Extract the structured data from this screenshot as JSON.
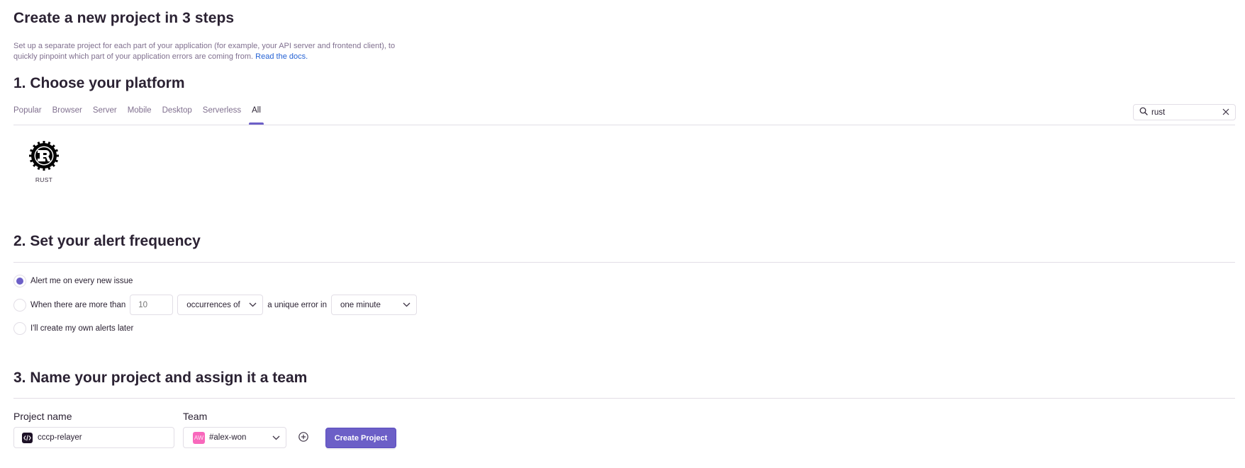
{
  "page": {
    "title": "Create a new project in 3 steps",
    "intro_text": "Set up a separate project for each part of your application (for example, your API server and frontend client), to quickly pinpoint which part of your application errors are coming from.",
    "docs_link": "Read the docs."
  },
  "platform": {
    "heading": "1. Choose your platform",
    "tabs": [
      {
        "label": "Popular",
        "active": false
      },
      {
        "label": "Browser",
        "active": false
      },
      {
        "label": "Server",
        "active": false
      },
      {
        "label": "Mobile",
        "active": false
      },
      {
        "label": "Desktop",
        "active": false
      },
      {
        "label": "Serverless",
        "active": false
      },
      {
        "label": "All",
        "active": true
      }
    ],
    "search_value": "rust",
    "results": [
      {
        "label": "RUST",
        "icon": "rust-logo-icon"
      }
    ]
  },
  "alerts": {
    "heading": "2. Set your alert frequency",
    "option_every_issue": "Alert me on every new issue",
    "option_threshold_prefix": "When there are more than",
    "threshold_placeholder": "10",
    "metric_select": "occurrences of",
    "threshold_middle": "a unique error in",
    "interval_select": "one minute",
    "option_later": "I'll create my own alerts later",
    "selected": "every_issue"
  },
  "project": {
    "heading": "3. Name your project and assign it a team",
    "name_label": "Project name",
    "name_value": "cccp-relayer",
    "team_label": "Team",
    "team_avatar": "AW",
    "team_value": "#alex-won",
    "create_button": "Create Project"
  },
  "colors": {
    "accent": "#6c5fc7",
    "link": "#2562d4",
    "muted": "#80708f",
    "avatar": "#f868bc"
  }
}
